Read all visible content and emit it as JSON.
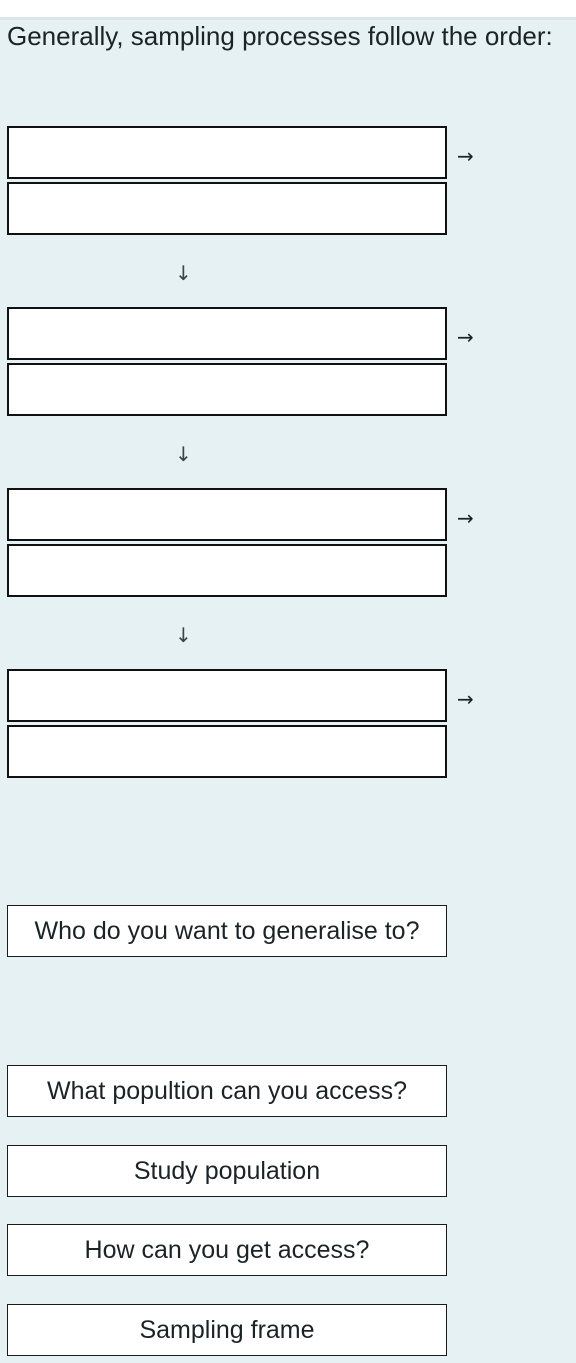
{
  "prompt": "Generally, sampling processes follow the order:",
  "flow": {
    "rows": [
      {
        "slots": [
          "",
          ""
        ],
        "right_arrow_icon": "→",
        "down_arrow_icon": "↓"
      },
      {
        "slots": [
          "",
          ""
        ],
        "right_arrow_icon": "→",
        "down_arrow_icon": "↓"
      },
      {
        "slots": [
          "",
          ""
        ],
        "right_arrow_icon": "→",
        "down_arrow_icon": "↓"
      },
      {
        "slots": [
          "",
          ""
        ],
        "right_arrow_icon": "→"
      }
    ]
  },
  "drag_items": [
    {
      "label": "Who do you want to generalise to?"
    },
    {
      "label": "What popultion can you access?"
    },
    {
      "label": "Study population"
    },
    {
      "label": "How can you get access?"
    },
    {
      "label": "Sampling frame"
    }
  ],
  "colors": {
    "background": "#e6f1f4",
    "box_fill": "#ffffff",
    "box_border": "#111111",
    "text": "#1b2327"
  }
}
